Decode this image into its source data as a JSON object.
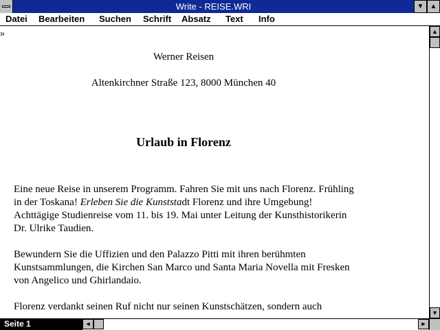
{
  "window": {
    "title": "Write - REISE.WRI",
    "minimize_glyph": "▼",
    "maximize_glyph": "▲"
  },
  "menubar": {
    "items": [
      {
        "label": "Datei"
      },
      {
        "label": "Bearbeiten"
      },
      {
        "label": "Suchen"
      },
      {
        "label": "Schrift"
      },
      {
        "label": "Absatz"
      },
      {
        "label": "Text"
      },
      {
        "label": "Info"
      }
    ]
  },
  "document": {
    "marker": "»",
    "sender_name": "Werner Reisen",
    "sender_address": "Altenkirchner Straße 123, 8000 München 40",
    "heading": "Urlaub in Florenz",
    "para1_before_italic": "Eine neue Reise in unserem Programm. Fahren Sie mit uns nach Florenz. Frühling in der Toskana! ",
    "para1_italic": "Erleben Sie die Kunststa",
    "para1_after_italic": "dt Florenz und ihre Umgebung! Achttägige Studienreise vom 11. bis 19. Mai unter Leitung der Kunsthistorikerin Dr. Ulrike Taudien.",
    "para2": "Bewundern Sie die Uffizien und den Palazzo Pitti mit ihren berühmten Kunstsammlungen, die Kirchen San Marco und Santa Maria Novella mit Fresken von Angelico und Ghirlandaio.",
    "para3": "Florenz verdankt seinen Ruf nicht nur seinen Kunstschätzen, sondern auch"
  },
  "scrollbars": {
    "up_glyph": "▲",
    "down_glyph": "▼",
    "left_glyph": "◄",
    "right_glyph": "►"
  },
  "status": {
    "page_label": "Seite 1"
  }
}
